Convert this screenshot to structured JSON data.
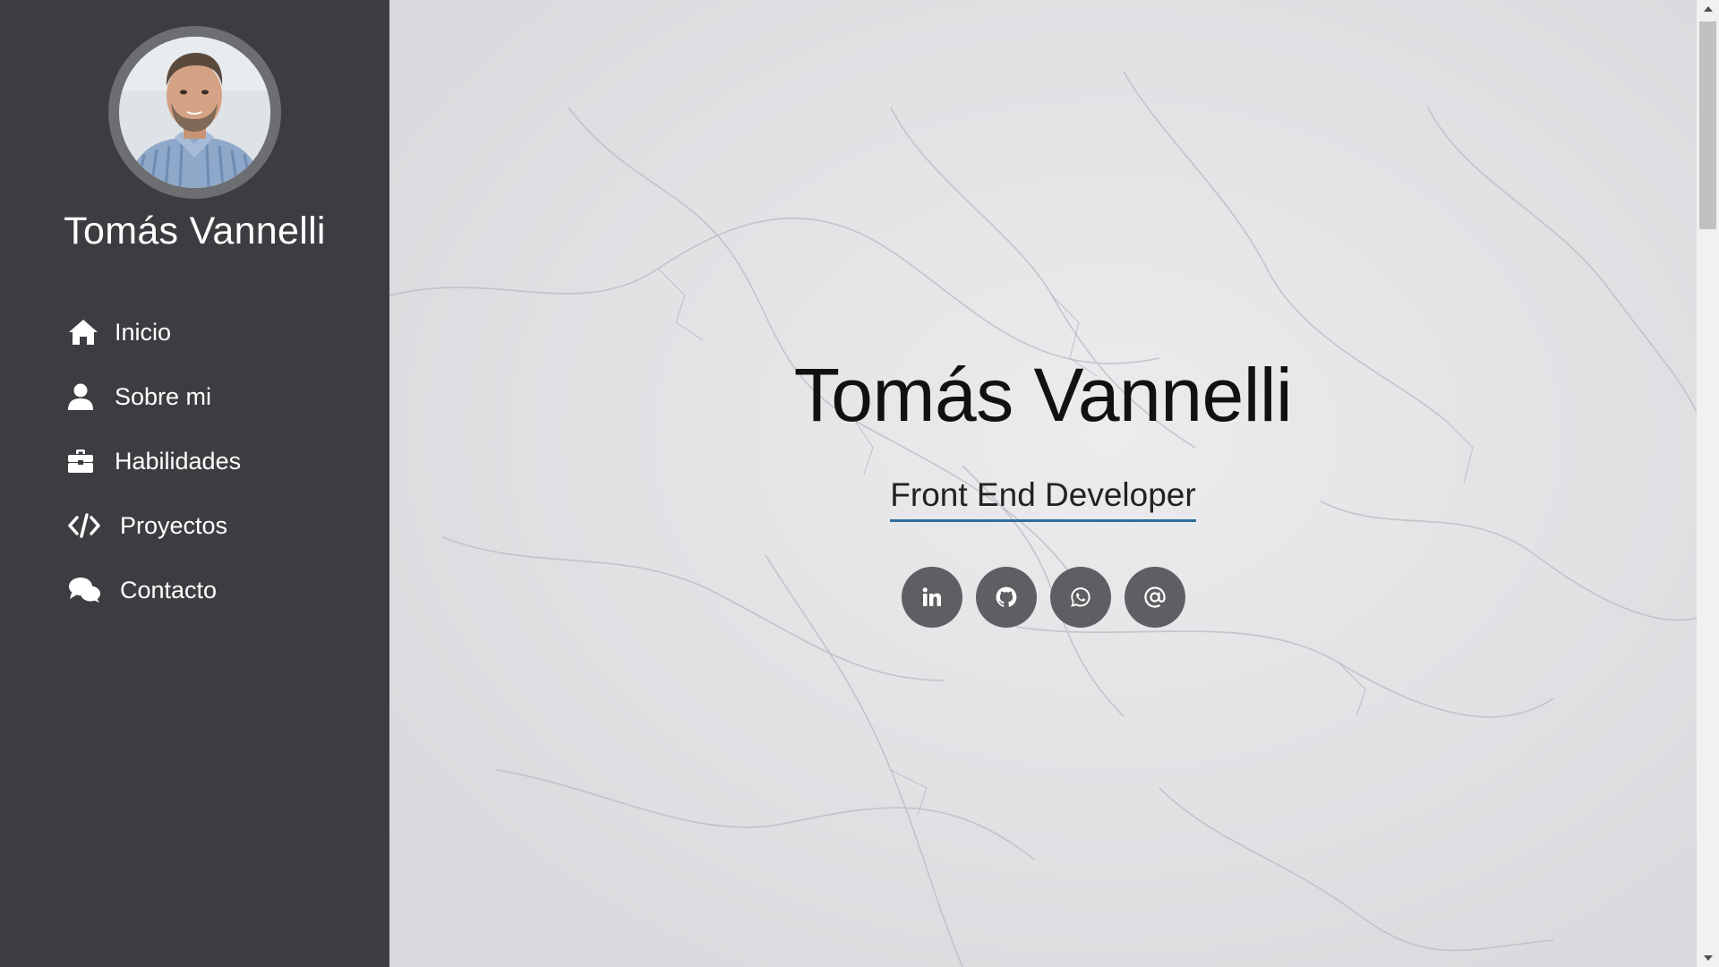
{
  "sidebar": {
    "name": "Tomás Vannelli",
    "avatar_icon": "profile-photo",
    "items": [
      {
        "label": "Inicio",
        "icon": "home-icon"
      },
      {
        "label": "Sobre mi",
        "icon": "user-icon"
      },
      {
        "label": "Habilidades",
        "icon": "briefcase-icon"
      },
      {
        "label": "Proyectos",
        "icon": "code-icon"
      },
      {
        "label": "Contacto",
        "icon": "comments-icon"
      }
    ]
  },
  "hero": {
    "title": "Tomás Vannelli",
    "subtitle": "Front End Developer",
    "socials": [
      {
        "icon": "linkedin-icon"
      },
      {
        "icon": "github-icon"
      },
      {
        "icon": "whatsapp-icon"
      },
      {
        "icon": "at-sign-icon"
      }
    ]
  },
  "colors": {
    "sidebar_bg": "#3c3d40",
    "accent_underline": "#2f6d9a",
    "social_button_bg": "#5e5f62"
  }
}
